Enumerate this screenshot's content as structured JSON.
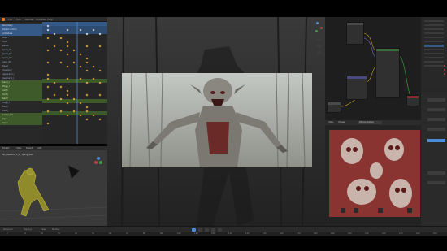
{
  "menubar": {
    "items": [
      "File",
      "Edit",
      "Render",
      "Window",
      "Help"
    ],
    "viewport_menu": [
      "Object Mode",
      "View",
      "Select",
      "Add",
      "Object"
    ]
  },
  "outliner": {
    "rows": [
      {
        "label": "Summary",
        "state": "sel"
      },
      {
        "label": "Object Action",
        "state": "sel"
      },
      {
        "label": "Armature",
        "state": "sel"
      },
      {
        "label": "Pose",
        "state": "normal"
      },
      {
        "label": "root",
        "state": "normal"
      },
      {
        "label": "pelvis",
        "state": "normal"
      },
      {
        "label": "spine_01",
        "state": "normal"
      },
      {
        "label": "spine_02",
        "state": "normal"
      },
      {
        "label": "spine_03",
        "state": "normal"
      },
      {
        "label": "neck_01",
        "state": "normal"
      },
      {
        "label": "head",
        "state": "normal"
      },
      {
        "label": "clavicle_l",
        "state": "normal"
      },
      {
        "label": "upperarm_l",
        "state": "normal"
      },
      {
        "label": "lowerarm_l",
        "state": "normal"
      },
      {
        "label": "hand_l",
        "state": "green"
      },
      {
        "label": "thigh_l",
        "state": "green"
      },
      {
        "label": "calf_l",
        "state": "green"
      },
      {
        "label": "foot_l",
        "state": "green"
      },
      {
        "label": "ball_l",
        "state": "green"
      },
      {
        "label": "thigh_r",
        "state": "normal"
      },
      {
        "label": "calf_r",
        "state": "normal"
      },
      {
        "label": "foot_r",
        "state": "normal"
      },
      {
        "label": "Lower Jaw",
        "state": "green"
      },
      {
        "label": "Lip L",
        "state": "green"
      },
      {
        "label": "Lip R",
        "state": "green"
      }
    ]
  },
  "view3d": {
    "header": [
      "Object",
      "View",
      "Select",
      "Add"
    ],
    "stats": "SK_Creature | 1_G_ Typing_dark"
  },
  "image_editor": {
    "header": [
      "View",
      "Image",
      "Diffuse Texture"
    ]
  },
  "timeline": {
    "menus": [
      "Playback",
      "Keying",
      "View",
      "Marker"
    ],
    "frames": [
      "0",
      "10",
      "20",
      "30",
      "40",
      "50",
      "60",
      "70",
      "80",
      "90",
      "100",
      "110",
      "120",
      "130",
      "140",
      "150",
      "160",
      "170",
      "180",
      "190",
      "200",
      "210",
      "220",
      "230",
      "240",
      "250"
    ]
  },
  "colors": {
    "keyframe": "#e8a93a",
    "selection": "#355a88",
    "accent": "#4a8cd8"
  }
}
